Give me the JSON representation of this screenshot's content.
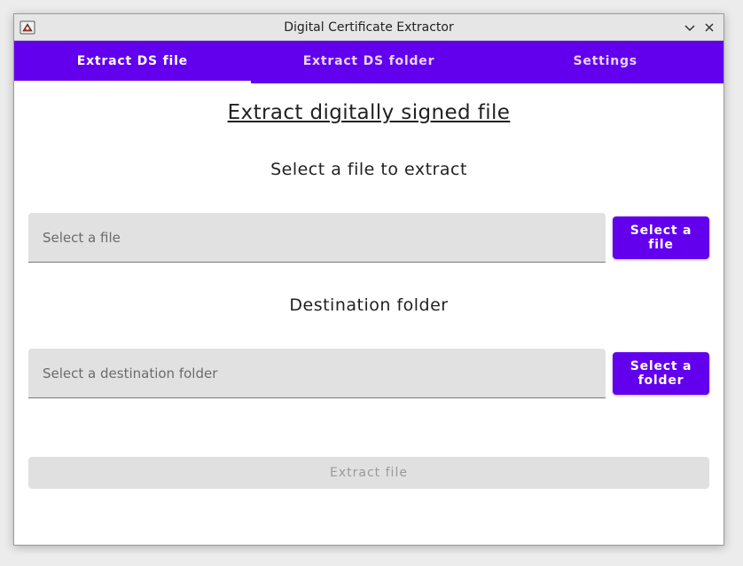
{
  "window": {
    "title": "Digital Certificate Extractor"
  },
  "tabs": [
    {
      "label": "Extract DS file",
      "active": true
    },
    {
      "label": "Extract DS folder",
      "active": false
    },
    {
      "label": "Settings",
      "active": false
    }
  ],
  "main": {
    "heading": "Extract digitally signed file",
    "file_section": {
      "label": "Select a file to extract",
      "placeholder": "Select a file",
      "button_label": "Select a file"
    },
    "folder_section": {
      "label": "Destination folder",
      "placeholder": "Select a destination folder",
      "button_label": "Select a folder"
    },
    "extract_button_label": "Extract file"
  },
  "colors": {
    "accent": "#6200ee",
    "field_bg": "#e1e1e1",
    "disabled_bg": "#e0e0e0"
  },
  "icons": [
    "app-icon",
    "chevron-down-icon",
    "close-icon"
  ]
}
